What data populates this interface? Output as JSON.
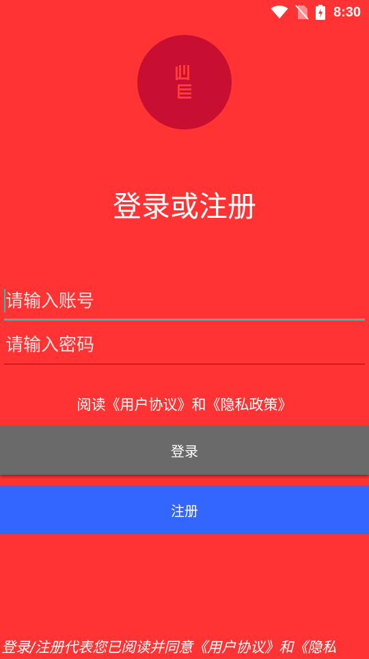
{
  "status_bar": {
    "time": "8:30",
    "icons": [
      "wifi-icon",
      "no-sim-icon",
      "battery-charging-icon"
    ]
  },
  "logo": {
    "icon": "app-logo-icon",
    "circle_color": "#C80F32"
  },
  "title": "登录或注册",
  "account_field": {
    "value": "",
    "placeholder": "请输入账号"
  },
  "password_field": {
    "value": "",
    "placeholder": "请输入密码"
  },
  "agreement_link": "阅读《用户协议》和《隐私政策》",
  "login_button": "登录",
  "register_button": "注册",
  "footer_notice": "登录/注册代表您已阅读并同意《用户协议》和《隐私",
  "colors": {
    "background": "#FF3333",
    "accent": "#27C4B4",
    "login_button": "#6A6A6A",
    "register_button": "#3366FF"
  }
}
